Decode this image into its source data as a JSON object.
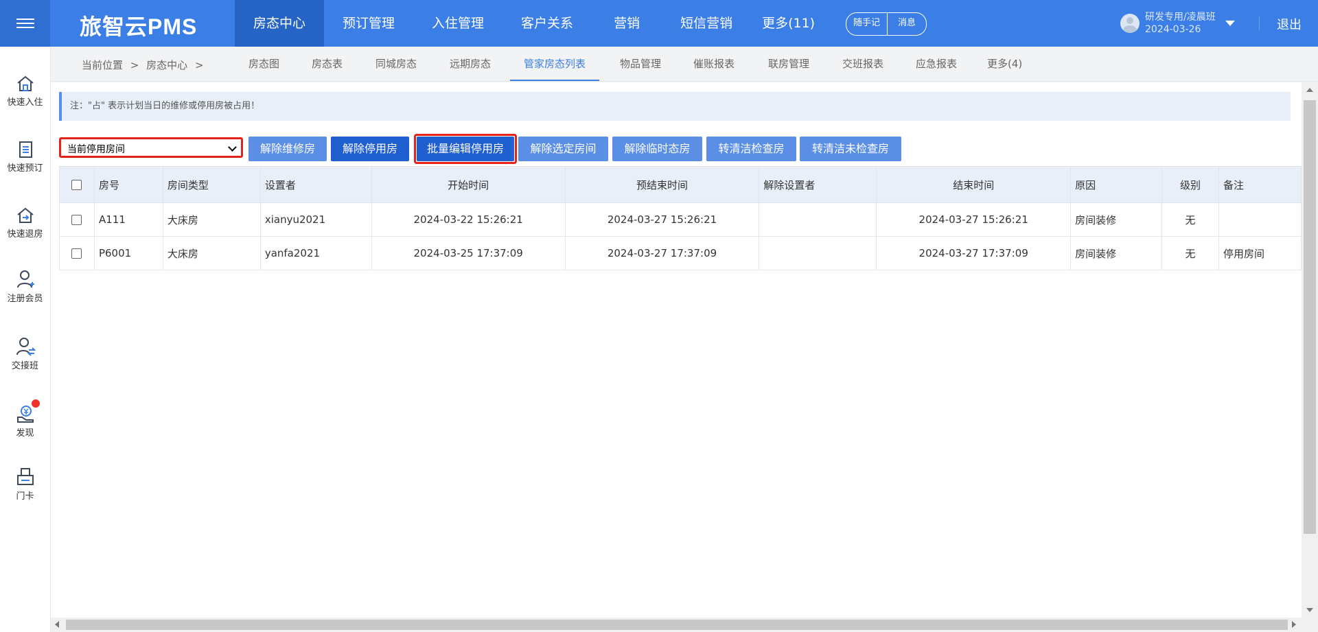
{
  "header": {
    "brand": "旅智云PMS",
    "nav": [
      "房态中心",
      "预订管理",
      "入住管理",
      "客户关系",
      "营销",
      "短信营销",
      "更多(11)"
    ],
    "memo_label": "随手记",
    "message_label": "消息",
    "user_name": "研发专用/凌晨班",
    "user_date": "2024-03-26",
    "logout_label": "退出"
  },
  "sidebar": {
    "items": [
      "快速入住",
      "快速预订",
      "快速退房",
      "注册会员",
      "交接班",
      "发现",
      "门卡"
    ]
  },
  "subnav": {
    "crumb_prefix": "当前位置",
    "crumb_current": "房态中心",
    "tabs": [
      "房态图",
      "房态表",
      "同城房态",
      "远期房态",
      "管家房态列表",
      "物品管理",
      "催账报表",
      "联房管理",
      "交班报表",
      "应急报表",
      "更多(4)"
    ]
  },
  "notice": "注：\"占\" 表示计划当日的维修或停用房被占用！",
  "filter": {
    "selected": "当前停用房间"
  },
  "actions": [
    "解除维修房",
    "解除停用房",
    "批量编辑停用房",
    "解除选定房间",
    "解除临时态房",
    "转清洁检查房",
    "转清洁未检查房"
  ],
  "table": {
    "headers": [
      "房号",
      "房间类型",
      "设置者",
      "开始时间",
      "预结束时间",
      "解除设置者",
      "结束时间",
      "原因",
      "级别",
      "备注"
    ],
    "rows": [
      [
        "A111",
        "大床房",
        "xianyu2021",
        "2024-03-22 15:26:21",
        "2024-03-27 15:26:21",
        "",
        "2024-03-27 15:26:21",
        "房间装修",
        "无",
        ""
      ],
      [
        "P6001",
        "大床房",
        "yanfa2021",
        "2024-03-25 17:37:09",
        "2024-03-27 17:37:09",
        "",
        "2024-03-27 17:37:09",
        "房间装修",
        "无",
        "停用房间"
      ]
    ]
  },
  "colors": {
    "primary": "#3a7ee6",
    "primary_dark": "#2563c4",
    "button": "#5b8fe6",
    "button_active": "#1f5fd0",
    "highlight": "#e32219"
  }
}
